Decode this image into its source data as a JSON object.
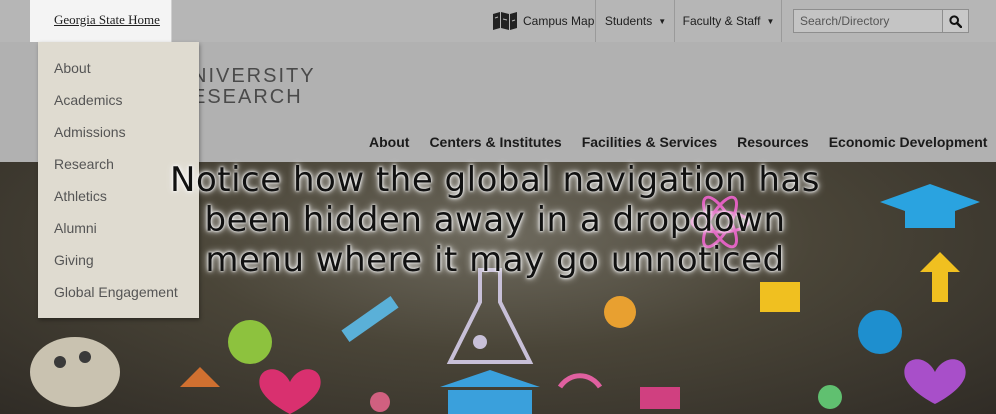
{
  "topbar": {
    "home_link": "Georgia State Home",
    "campus_map": "Campus Map",
    "students": "Students",
    "faculty_staff": "Faculty & Staff",
    "search_placeholder": "Search/Directory"
  },
  "logo": {
    "line1": "NIVERSITY",
    "line2": "ESEARCH"
  },
  "dropdown": {
    "items": [
      "About",
      "Academics",
      "Admissions",
      "Research",
      "Athletics",
      "Alumni",
      "Giving",
      "Global Engagement"
    ]
  },
  "mainnav": {
    "items": [
      "About",
      "Centers & Institutes",
      "Facilities & Services",
      "Resources",
      "Economic Development"
    ]
  },
  "annotation": {
    "line1": "Notice how the global navigation has",
    "line2": "been hidden away in a dropdown",
    "line3": "menu where it may go unnoticed"
  },
  "colors": {
    "dropdown_bg": "#dfdbd0",
    "topbar_bg": "#b6b6b6",
    "header_bg": "#b1b1b1"
  }
}
